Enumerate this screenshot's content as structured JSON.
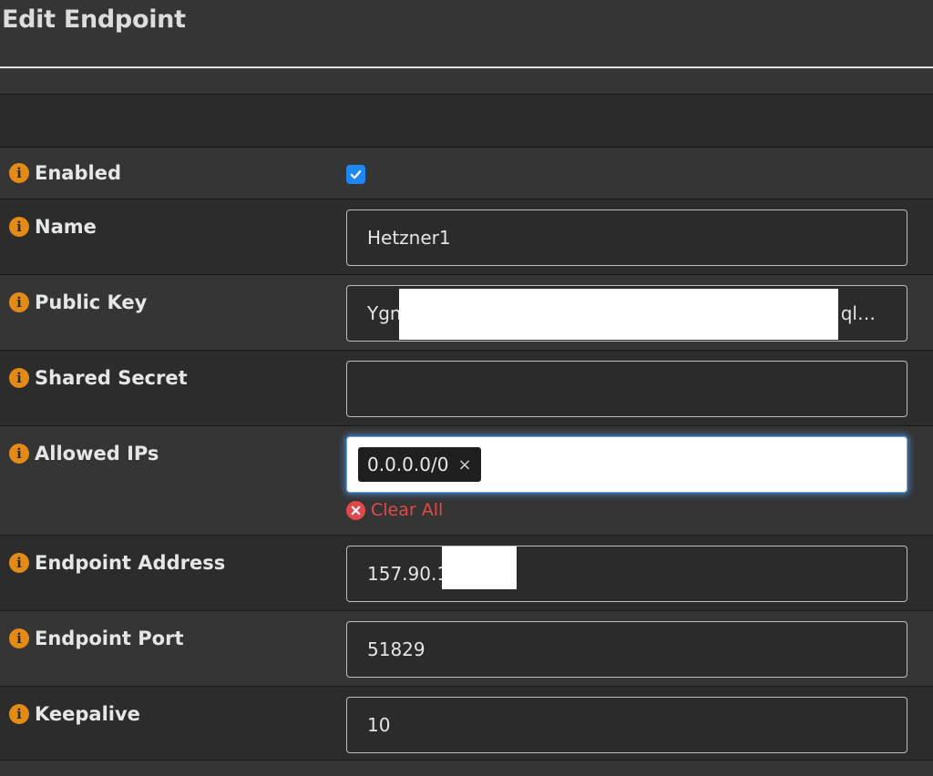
{
  "dialog": {
    "title": "Edit Endpoint"
  },
  "fields": {
    "enabled": {
      "label": "Enabled",
      "checked": true
    },
    "name": {
      "label": "Name",
      "value": "Hetzner1"
    },
    "public_key": {
      "label": "Public Key",
      "value_prefix": "Ygn",
      "value_suffix": "ql…"
    },
    "shared_secret": {
      "label": "Shared Secret",
      "value": ""
    },
    "allowed_ips": {
      "label": "Allowed IPs",
      "tags": [
        "0.0.0.0/0"
      ],
      "tag_remove": "×",
      "clear_all_label": "Clear All"
    },
    "endpoint_address": {
      "label": "Endpoint Address",
      "value": "157.90.1"
    },
    "endpoint_port": {
      "label": "Endpoint Port",
      "value": "51829"
    },
    "keepalive": {
      "label": "Keepalive",
      "value": "10"
    }
  },
  "icons": {
    "info": "info-icon",
    "check": "check-icon",
    "clear": "times-circle-icon"
  },
  "colors": {
    "accent_info": "#e48a16",
    "checkbox": "#1e88f2",
    "danger": "#e0484c",
    "focus": "#6aa7e8"
  }
}
